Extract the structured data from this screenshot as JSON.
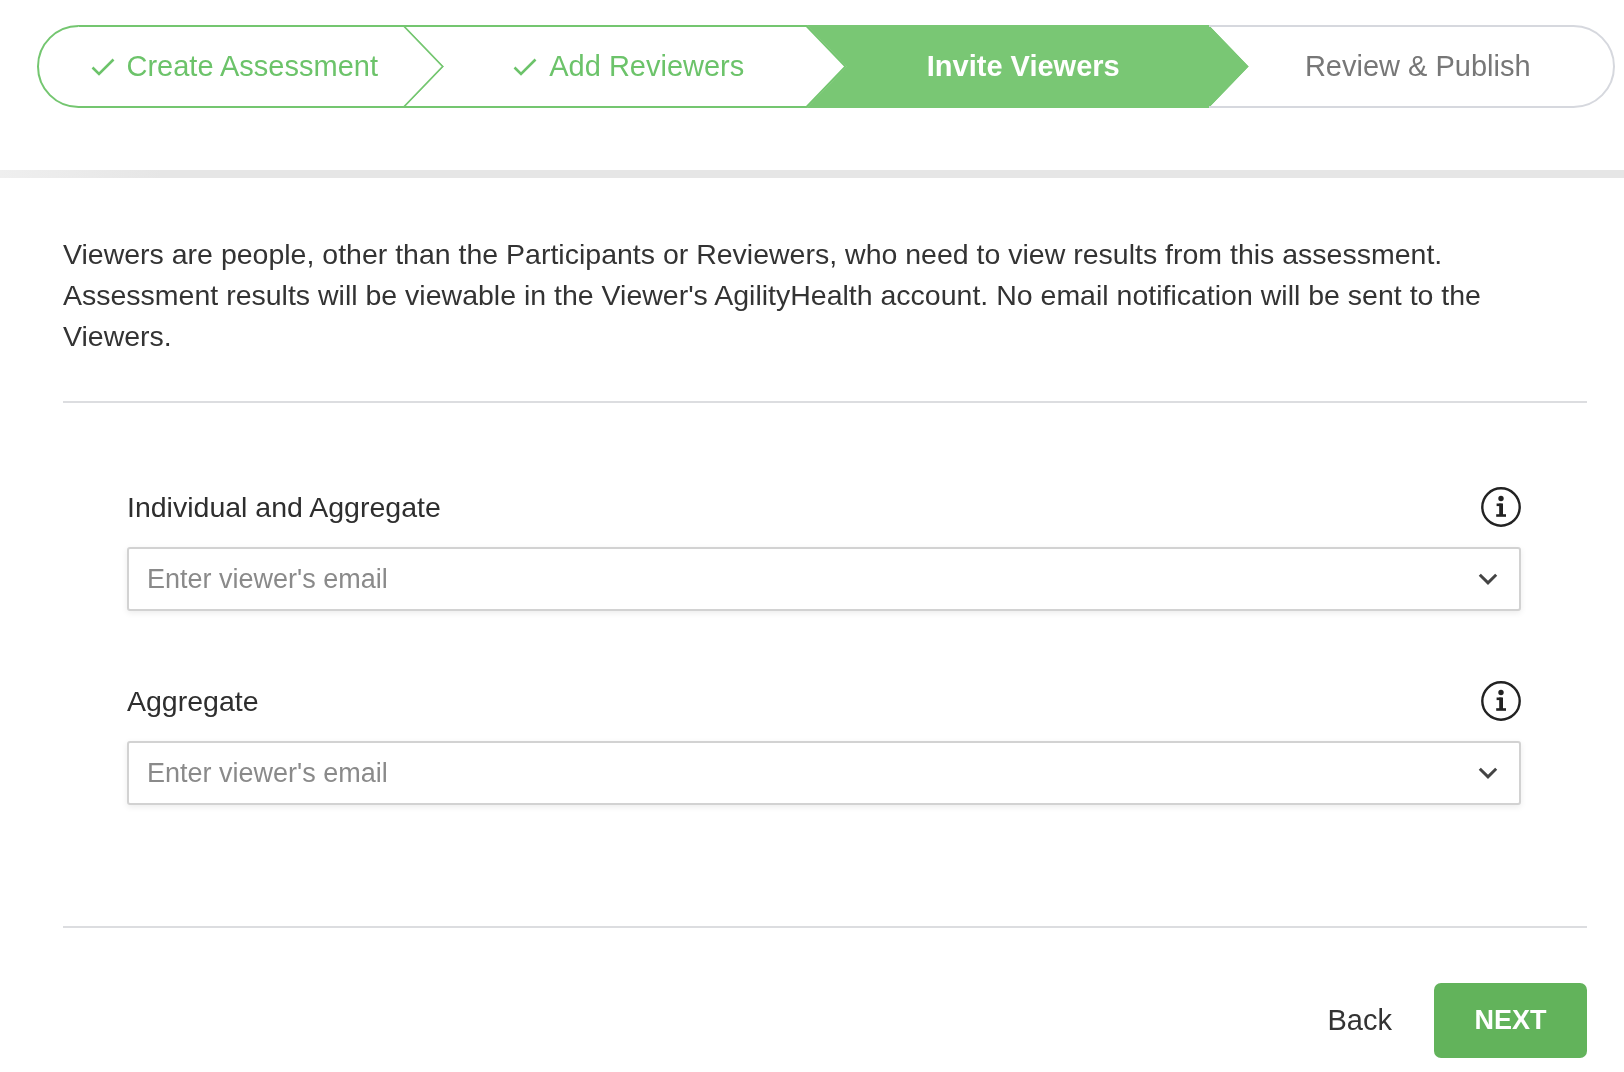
{
  "stepper": {
    "steps": [
      {
        "label": "Create Assessment",
        "completed": true,
        "selected": false
      },
      {
        "label": "Add Reviewers",
        "completed": true,
        "selected": false
      },
      {
        "label": "Invite Viewers",
        "completed": false,
        "selected": true
      },
      {
        "label": "Review & Publish",
        "completed": false,
        "selected": false
      }
    ]
  },
  "description": "Viewers are people, other than the Participants or Reviewers, who need to view results from this assessment. Assessment results will be viewable in the Viewer's AgilityHealth account. No email notification will be sent to the Viewers.",
  "fields": [
    {
      "label": "Individual and Aggregate",
      "placeholder": "Enter viewer's email"
    },
    {
      "label": "Aggregate",
      "placeholder": "Enter viewer's email"
    }
  ],
  "buttons": [
    {
      "label": "Back",
      "kind": "link"
    },
    {
      "label": "NEXT",
      "kind": "primary"
    }
  ]
}
